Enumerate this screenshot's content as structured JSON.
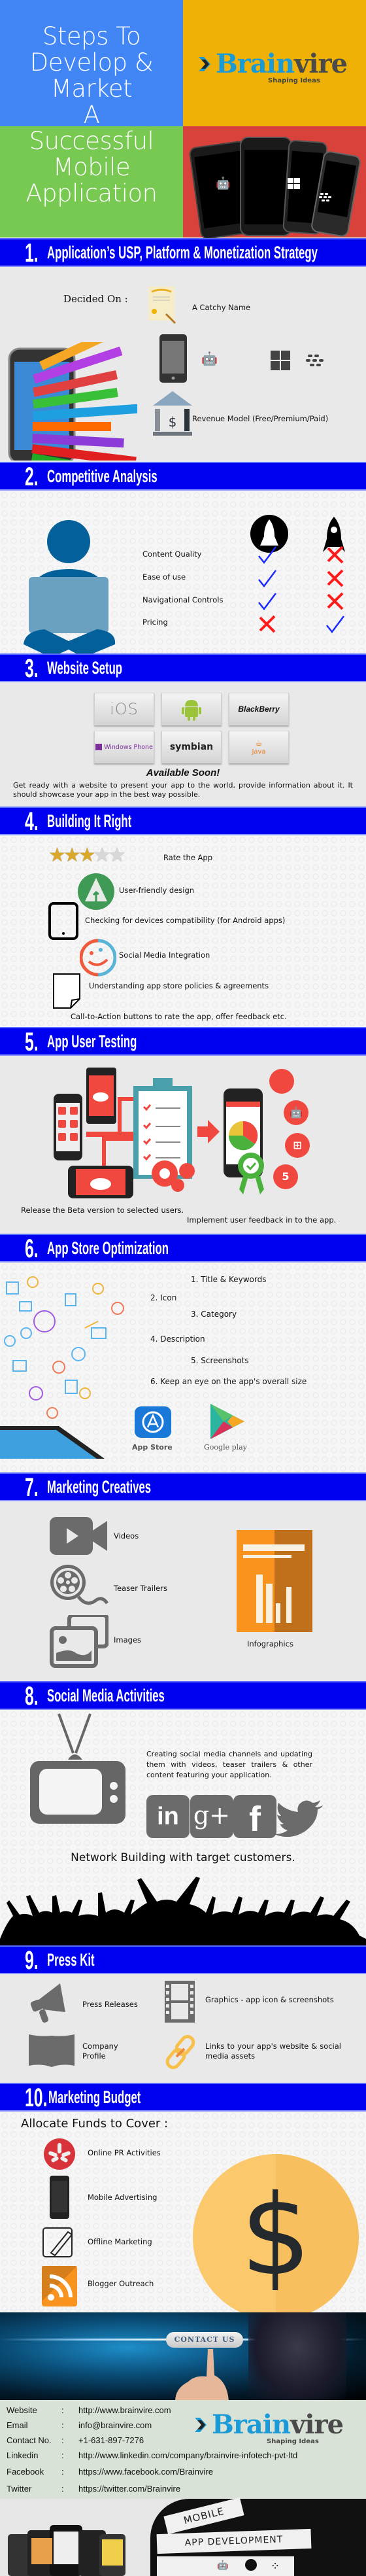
{
  "hero": {
    "title_lines": [
      "Steps To",
      "Develop &",
      "Market",
      "A",
      "Successful",
      "Mobile",
      "Application"
    ],
    "brand": {
      "name_part1": "Brain",
      "name_part2": "vire",
      "tagline": "Shaping Ideas"
    },
    "phone_platforms": [
      "android-icon",
      "apple-icon",
      "windows-icon",
      "blackberry-icon"
    ],
    "colors": {
      "blue": "#4186f4",
      "yellow": "#efb105",
      "green": "#78c951",
      "red": "#d8423a"
    }
  },
  "sections": [
    {
      "number": "1.",
      "title": "Application’s USP, Platform & Monetization Strategy",
      "decided_on_label": "Decided On :",
      "items": [
        {
          "icon": "certificate-icon",
          "label": "A Catchy Name"
        },
        {
          "icon": "smartphone-icon",
          "label": "",
          "platforms": [
            "android-icon",
            "apple-icon",
            "windows-icon",
            "blackberry-icon"
          ]
        },
        {
          "icon": "bank-icon",
          "label": "Revenue Model (Free/Premium/Paid)"
        }
      ]
    },
    {
      "number": "2.",
      "title": "Competitive Analysis",
      "columns": [
        "rocket-circle-icon",
        "rocket-icon"
      ],
      "rows": [
        {
          "label": "Content Quality",
          "col1": "check",
          "col2": "cross"
        },
        {
          "label": "Ease of use",
          "col1": "check",
          "col2": "cross"
        },
        {
          "label": "Navigational Controls",
          "col1": "check",
          "col2": "cross"
        },
        {
          "label": "Pricing",
          "col1": "cross",
          "col2": "check"
        }
      ]
    },
    {
      "number": "3.",
      "title": "Website Setup",
      "platform_tiles": [
        "iOS",
        "android",
        "BlackBerry",
        "Windows Phone",
        "symbian",
        "Java"
      ],
      "available_soon": "Available Soon!",
      "description": "Get ready with a website to present your app to the world, provide information about it. It should showcase your app in the best way possible."
    },
    {
      "number": "4.",
      "title": "Building It Right",
      "rating": {
        "value": 3,
        "max": 5,
        "label": "Rate the App"
      },
      "items": [
        {
          "icon": "forest-icon",
          "label": "User-friendly design"
        },
        {
          "icon": "tablet-icon",
          "label": "Checking for devices compatibility (for Android apps)"
        },
        {
          "icon": "smiley-icon",
          "label": "Social Media Integration"
        },
        {
          "icon": "document-icon",
          "label": "Understanding app store policies & agreements"
        },
        {
          "icon": "",
          "label": "Call-to-Action buttons to rate the app, offer feedback etc."
        }
      ]
    },
    {
      "number": "5.",
      "title": "App User Testing",
      "line1": "Release the Beta version to selected users.",
      "line2": "Implement user feedback in to the app.",
      "platform_badges": [
        "apple-icon",
        "android-icon",
        "windows-icon",
        "html5-icon"
      ]
    },
    {
      "number": "6.",
      "title": "App Store Optimization",
      "items": [
        "1. Title & Keywords",
        "2. Icon",
        "3. Category",
        "4. Description",
        "5. Screenshots",
        "6. Keep an eye on the app's overall size"
      ],
      "stores": [
        {
          "icon": "app-store-icon",
          "label": "App Store"
        },
        {
          "icon": "google-play-icon",
          "label": "Google play"
        }
      ]
    },
    {
      "number": "7.",
      "title": "Marketing Creatives",
      "items": [
        {
          "icon": "video-camera-icon",
          "label": "Videos"
        },
        {
          "icon": "film-reel-icon",
          "label": "Teaser Trailers"
        },
        {
          "icon": "images-icon",
          "label": "Images"
        },
        {
          "icon": "infographic-icon",
          "label": "Infographics"
        }
      ]
    },
    {
      "number": "8.",
      "title": "Social Media Activities",
      "description": "Creating social media channels and updating them with videos, teaser trailers & other content featuring your application.",
      "networks": [
        "linkedin-icon",
        "google-plus-icon",
        "facebook-icon",
        "twitter-icon"
      ],
      "tagline": "Network Building with target customers."
    },
    {
      "number": "9.",
      "title": "Press Kit",
      "items": [
        {
          "icon": "megaphone-icon",
          "label": "Press Releases"
        },
        {
          "icon": "film-strip-icon",
          "label": "Graphics - app icon & screenshots"
        },
        {
          "icon": "book-icon",
          "label": "Company Profile"
        },
        {
          "icon": "chain-link-icon",
          "label": "Links to your app's website & social media assets"
        }
      ]
    },
    {
      "number": "10.",
      "title": "Marketing Budget",
      "subtitle": "Allocate Funds to Cover :",
      "items": [
        {
          "icon": "yelp-icon",
          "label": "Online PR Activities"
        },
        {
          "icon": "mobile-phone-icon",
          "label": "Mobile Advertising"
        },
        {
          "icon": "pencil-note-icon",
          "label": "Offline Marketing"
        },
        {
          "icon": "rss-icon",
          "label": "Blogger Outreach"
        }
      ]
    }
  ],
  "contact": {
    "button_label": "CONTACT US",
    "rows": [
      {
        "label": "Website",
        "value": "http://www.brainvire.com"
      },
      {
        "label": "Email",
        "value": "info@brainvire.com"
      },
      {
        "label": "Contact No.",
        "value": "+1-631-897-7276"
      },
      {
        "label": "Linkedin",
        "value": "http://www.linkedin.com/company/brainvire-infotech-pvt-ltd"
      },
      {
        "label": "Facebook",
        "value": "https://www.facebook.com/Brainvire"
      },
      {
        "label": "Twitter",
        "value": "https://twitter.com/Brainvire"
      }
    ],
    "separator": ":"
  },
  "footer_banner": {
    "ribbon1": "MOBILE",
    "ribbon2": "APP DEVELOPMENT"
  },
  "header_color": "#0000f0"
}
